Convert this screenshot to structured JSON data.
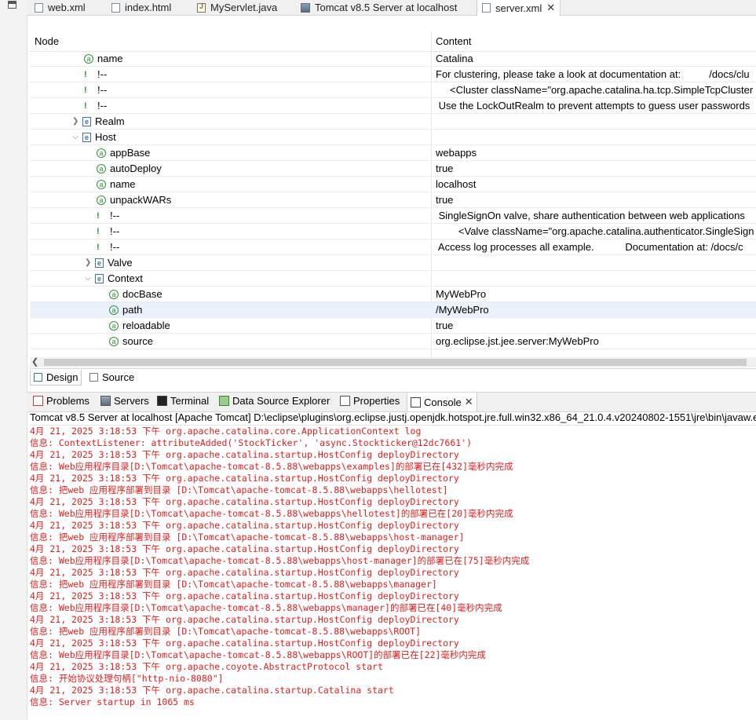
{
  "editor_tabs": [
    {
      "label": "web.xml",
      "icon": "xml-file-icon"
    },
    {
      "label": "index.html",
      "icon": "html-file-icon"
    },
    {
      "label": "MyServlet.java",
      "icon": "java-file-icon"
    },
    {
      "label": "Tomcat v8.5 Server at localhost",
      "icon": "server-icon"
    },
    {
      "label": "server.xml",
      "icon": "xml-file-icon",
      "active": true
    }
  ],
  "tree": {
    "headers": {
      "node": "Node",
      "content": "Content"
    },
    "rows": [
      {
        "type": "attribute",
        "node": "name",
        "content": "Catalina"
      },
      {
        "type": "comment",
        "node": "!--",
        "content": "For clustering, please take a look at documentation at:          /docs/clu"
      },
      {
        "type": "comment",
        "node": "!--",
        "content": "     <Cluster className=\"org.apache.catalina.ha.tcp.SimpleTcpCluster"
      },
      {
        "type": "comment",
        "node": "!--",
        "content": " Use the LockOutRealm to prevent attempts to guess user passwords"
      },
      {
        "type": "element",
        "node": "Realm",
        "content": ""
      },
      {
        "type": "element",
        "node": "Host",
        "content": ""
      },
      {
        "type": "attribute",
        "node": "appBase",
        "content": "webapps"
      },
      {
        "type": "attribute",
        "node": "autoDeploy",
        "content": "true"
      },
      {
        "type": "attribute",
        "node": "name",
        "content": "localhost"
      },
      {
        "type": "attribute",
        "node": "unpackWARs",
        "content": "true"
      },
      {
        "type": "comment",
        "node": "!--",
        "content": " SingleSignOn valve, share authentication between web applications"
      },
      {
        "type": "comment",
        "node": "!--",
        "content": "        <Valve className=\"org.apache.catalina.authenticator.SingleSign"
      },
      {
        "type": "comment",
        "node": "!--",
        "content": " Access log processes all example.           Documentation at: /docs/c"
      },
      {
        "type": "element",
        "node": "Valve",
        "content": ""
      },
      {
        "type": "element",
        "node": "Context",
        "content": ""
      },
      {
        "type": "attribute",
        "node": "docBase",
        "content": "MyWebPro"
      },
      {
        "type": "attribute",
        "node": "path",
        "content": "/MyWebPro",
        "selected": true
      },
      {
        "type": "attribute",
        "node": "reloadable",
        "content": "true"
      },
      {
        "type": "attribute",
        "node": "source",
        "content": "org.eclipse.jst.jee.server:MyWebPro"
      }
    ]
  },
  "design_tabs": [
    {
      "label": "Design",
      "active": true
    },
    {
      "label": "Source"
    }
  ],
  "view_tabs": [
    {
      "label": "Problems",
      "icon": "problems-icon"
    },
    {
      "label": "Servers",
      "icon": "servers-icon"
    },
    {
      "label": "Terminal",
      "icon": "terminal-icon"
    },
    {
      "label": "Data Source Explorer",
      "icon": "data-source-icon"
    },
    {
      "label": "Properties",
      "icon": "properties-icon"
    },
    {
      "label": "Console",
      "icon": "console-icon",
      "active": true
    }
  ],
  "console": {
    "title": "Tomcat v8.5 Server at localhost [Apache Tomcat] D:\\eclipse\\plugins\\org.eclipse.justj.openjdk.hotspot.jre.full.win32.x86_64_21.0.4.v20240802-1551\\jre\\bin\\javaw.exe",
    "text_color": "#e01e1e",
    "lines": [
      "4月 21, 2025 3:18:53 下午 org.apache.catalina.core.ApplicationContext log",
      "信息: ContextListener: attributeAdded('StockTicker', 'async.Stockticker@12dc7661')",
      "4月 21, 2025 3:18:53 下午 org.apache.catalina.startup.HostConfig deployDirectory",
      "信息: Web应用程序目录[D:\\Tomcat\\apache-tomcat-8.5.88\\webapps\\examples]的部署已在[432]毫秒内完成",
      "4月 21, 2025 3:18:53 下午 org.apache.catalina.startup.HostConfig deployDirectory",
      "信息: 把web 应用程序部署到目录 [D:\\Tomcat\\apache-tomcat-8.5.88\\webapps\\hellotest]",
      "4月 21, 2025 3:18:53 下午 org.apache.catalina.startup.HostConfig deployDirectory",
      "信息: Web应用程序目录[D:\\Tomcat\\apache-tomcat-8.5.88\\webapps\\hellotest]的部署已在[20]毫秒内完成",
      "4月 21, 2025 3:18:53 下午 org.apache.catalina.startup.HostConfig deployDirectory",
      "信息: 把web 应用程序部署到目录 [D:\\Tomcat\\apache-tomcat-8.5.88\\webapps\\host-manager]",
      "4月 21, 2025 3:18:53 下午 org.apache.catalina.startup.HostConfig deployDirectory",
      "信息: Web应用程序目录[D:\\Tomcat\\apache-tomcat-8.5.88\\webapps\\host-manager]的部署已在[75]毫秒内完成",
      "4月 21, 2025 3:18:53 下午 org.apache.catalina.startup.HostConfig deployDirectory",
      "信息: 把web 应用程序部署到目录 [D:\\Tomcat\\apache-tomcat-8.5.88\\webapps\\manager]",
      "4月 21, 2025 3:18:53 下午 org.apache.catalina.startup.HostConfig deployDirectory",
      "信息: Web应用程序目录[D:\\Tomcat\\apache-tomcat-8.5.88\\webapps\\manager]的部署已在[40]毫秒内完成",
      "4月 21, 2025 3:18:53 下午 org.apache.catalina.startup.HostConfig deployDirectory",
      "信息: 把web 应用程序部署到目录 [D:\\Tomcat\\apache-tomcat-8.5.88\\webapps\\ROOT]",
      "4月 21, 2025 3:18:53 下午 org.apache.catalina.startup.HostConfig deployDirectory",
      "信息: Web应用程序目录[D:\\Tomcat\\apache-tomcat-8.5.88\\webapps\\ROOT]的部署已在[22]毫秒内完成",
      "4月 21, 2025 3:18:53 下午 org.apache.coyote.AbstractProtocol start",
      "信息: 开始协议处理句柄[\"http-nio-8080\"]",
      "4月 21, 2025 3:18:53 下午 org.apache.catalina.startup.Catalina start",
      "信息: Server startup in 1065 ms"
    ]
  }
}
